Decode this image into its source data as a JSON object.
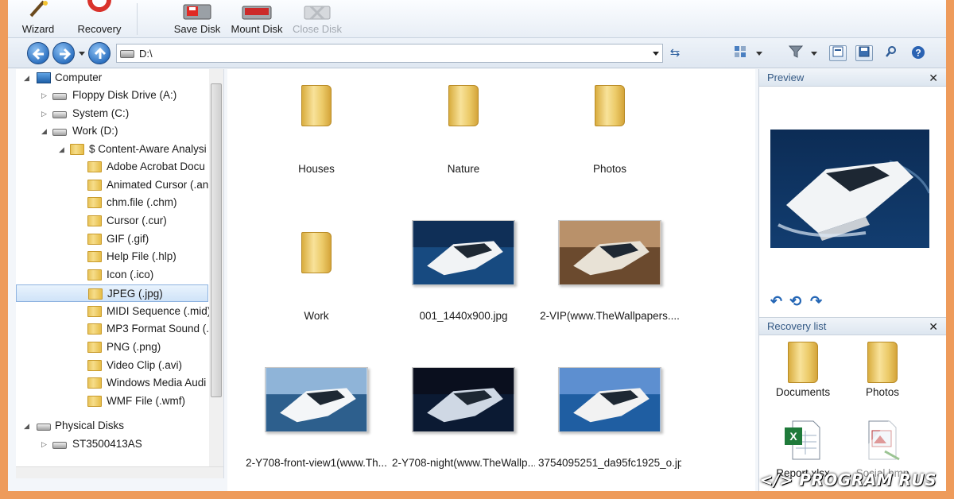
{
  "toolbar": {
    "buttons": [
      {
        "label": "Wizard",
        "icon": "wand-icon",
        "enabled": true
      },
      {
        "label": "Recovery",
        "icon": "lifebuoy-icon",
        "enabled": true
      },
      {
        "label": "Save Disk",
        "icon": "save-disk-icon",
        "enabled": true
      },
      {
        "label": "Mount Disk",
        "icon": "mount-disk-icon",
        "enabled": true
      },
      {
        "label": "Close Disk",
        "icon": "close-disk-icon",
        "enabled": false
      }
    ]
  },
  "navbar": {
    "address": "D:\\",
    "tools": [
      "view-mode-icon",
      "filter-icon",
      "preview-pane-icon",
      "save-icon",
      "search-icon",
      "help-icon"
    ]
  },
  "tree": {
    "items": [
      {
        "label": "Computer",
        "icon": "computer-icon",
        "expanded": true
      },
      {
        "label": "Floppy Disk Drive (A:)",
        "icon": "floppy-drive-icon",
        "expanded": false
      },
      {
        "label": "System (C:)",
        "icon": "system-drive-icon",
        "expanded": false
      },
      {
        "label": "Work (D:)",
        "icon": "drive-icon",
        "expanded": true
      },
      {
        "label": "$ Content-Aware Analysi",
        "icon": "folder-icon",
        "expanded": true
      },
      {
        "label": "Adobe Acrobat Docu",
        "icon": "folder-icon"
      },
      {
        "label": "Animated Cursor (.an",
        "icon": "folder-icon"
      },
      {
        "label": "chm.file (.chm)",
        "icon": "folder-icon"
      },
      {
        "label": "Cursor (.cur)",
        "icon": "folder-icon"
      },
      {
        "label": "GIF (.gif)",
        "icon": "folder-icon"
      },
      {
        "label": "Help File (.hlp)",
        "icon": "folder-icon"
      },
      {
        "label": "Icon (.ico)",
        "icon": "folder-icon"
      },
      {
        "label": "JPEG (.jpg)",
        "icon": "folder-icon",
        "selected": true
      },
      {
        "label": "MIDI Sequence (.mid)",
        "icon": "folder-icon"
      },
      {
        "label": "MP3 Format Sound (.",
        "icon": "folder-icon"
      },
      {
        "label": "PNG (.png)",
        "icon": "folder-icon"
      },
      {
        "label": "Video Clip (.avi)",
        "icon": "folder-icon"
      },
      {
        "label": "Windows Media Audi",
        "icon": "folder-icon"
      },
      {
        "label": "WMF File (.wmf)",
        "icon": "folder-icon"
      },
      {
        "label": "Physical Disks",
        "icon": "drive-icon",
        "expanded": true
      },
      {
        "label": "ST3500413AS",
        "icon": "drive-icon",
        "expanded": false
      }
    ]
  },
  "content": {
    "items": [
      {
        "label": "Houses",
        "kind": "folder"
      },
      {
        "label": "Nature",
        "kind": "folder"
      },
      {
        "label": "Photos",
        "kind": "folder"
      },
      {
        "label": "Work",
        "kind": "folder"
      },
      {
        "label": "001_1440x900.jpg",
        "kind": "image",
        "scene": "yacht-day"
      },
      {
        "label": "2-VIP(www.TheWallpapers....",
        "kind": "image",
        "scene": "cabin"
      },
      {
        "label": "2-Y708-front-view1(www.Th...",
        "kind": "image",
        "scene": "yacht-front"
      },
      {
        "label": "2-Y708-night(www.TheWallp...",
        "kind": "image",
        "scene": "yacht-night"
      },
      {
        "label": "3754095251_da95fc1925_o.jpg",
        "kind": "image",
        "scene": "yacht-harbor"
      }
    ]
  },
  "preview": {
    "title": "Preview",
    "close": "✕",
    "controls": [
      "rotate-left-icon",
      "rotate-both-icon",
      "rotate-right-icon"
    ]
  },
  "recovery": {
    "title": "Recovery list",
    "close": "✕",
    "items": [
      {
        "label": "Documents",
        "icon": "folder-icon"
      },
      {
        "label": "Photos",
        "icon": "folder-icon"
      },
      {
        "label": "Report.xlsx",
        "icon": "excel-file-icon"
      },
      {
        "label": "Social.bmp",
        "icon": "bitmap-file-icon"
      }
    ]
  },
  "watermark": "</> PROGRAM RUS",
  "colors": {
    "border": "#ee9b5b",
    "accent": "#2f73c2",
    "selection": "#cfe3f8"
  }
}
